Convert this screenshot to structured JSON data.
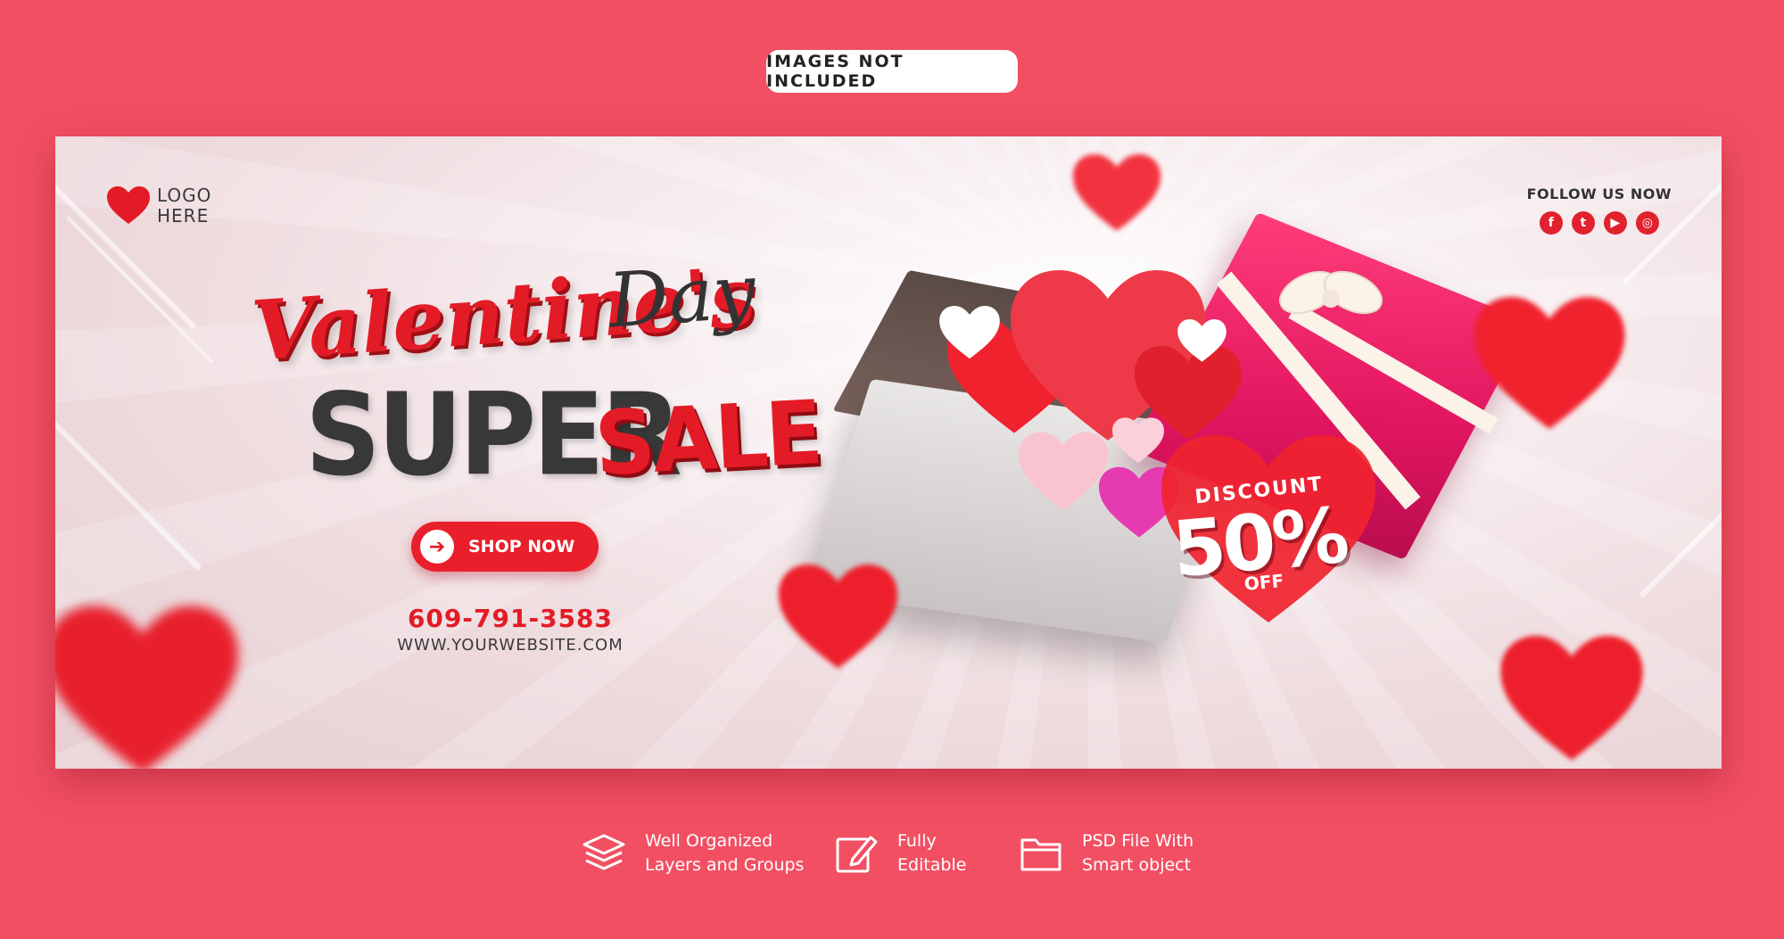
{
  "top_badge": "IMAGES NOT INCLUDED",
  "banner": {
    "logo": {
      "line1": "LOGO",
      "line2": "HERE",
      "icon": "heart-icon"
    },
    "follow": {
      "label": "FOLLOW US NOW",
      "icons": [
        "facebook-icon",
        "twitter-icon",
        "youtube-icon",
        "instagram-icon"
      ],
      "glyphs": [
        "f",
        "t",
        "▶",
        "◎"
      ]
    },
    "headline": {
      "script_red": "Valentine's",
      "script_dark": "Day",
      "line2_dark": "SUPER",
      "line2_red": "SALE"
    },
    "cta": {
      "label": "SHOP NOW",
      "icon": "arrow-right-icon"
    },
    "phone": "609-791-3583",
    "website": "WWW.YOURWEBSITE.COM",
    "discount": {
      "label": "DISCOUNT",
      "value": "50%",
      "suffix": "OFF"
    }
  },
  "features": [
    {
      "icon": "layers-icon",
      "line1": "Well Organized",
      "line2": "Layers and Groups"
    },
    {
      "icon": "edit-icon",
      "line1": "Fully",
      "line2": "Editable"
    },
    {
      "icon": "folder-icon",
      "line1": "PSD File With",
      "line2": "Smart object"
    }
  ],
  "colors": {
    "background": "#f24f63",
    "accent_red": "#e31b26",
    "dark_text": "#383838",
    "gift_pink": "#e21560"
  }
}
